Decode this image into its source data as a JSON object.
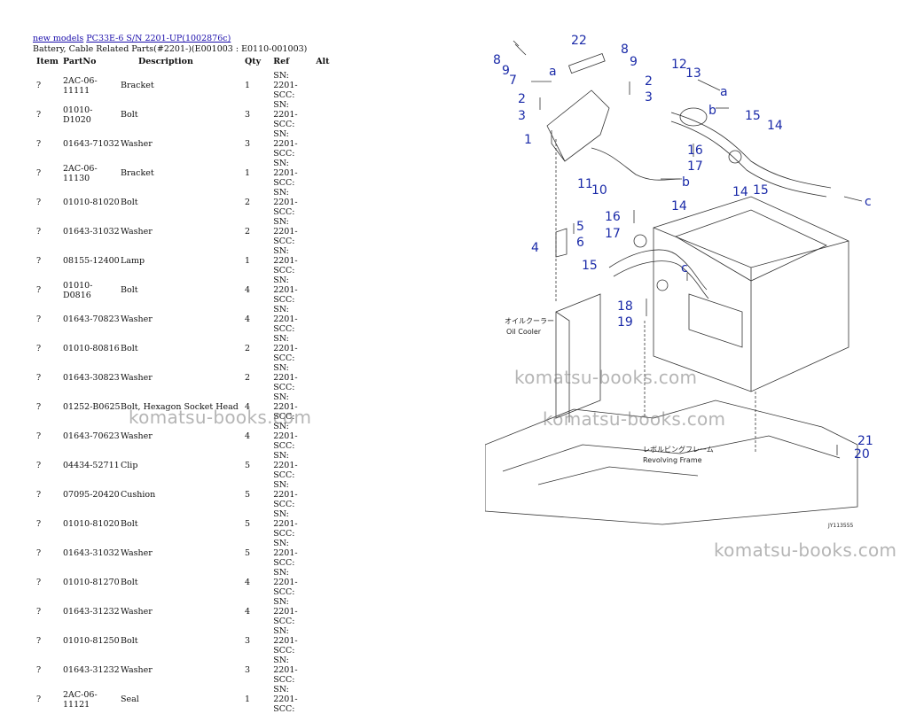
{
  "breadcrumb": {
    "link1": "new models",
    "link2": "PC33E-6 S/N 2201-UP(1002876c)"
  },
  "subtitle": "Battery, Cable Related Parts(#2201-)(E001003 : E0110-001003)",
  "table": {
    "headers": [
      "Item",
      "PartNo",
      "Description",
      "Qty",
      "Ref",
      "Alt"
    ],
    "rows": [
      {
        "item": "?",
        "part": "2AC-06-11111",
        "desc": "Bracket",
        "qty": "1",
        "ref": "SN: 2201- SCC:",
        "alt": ""
      },
      {
        "item": "?",
        "part": "01010-D1020",
        "desc": "Bolt",
        "qty": "3",
        "ref": "SN: 2201- SCC:",
        "alt": ""
      },
      {
        "item": "?",
        "part": "01643-71032",
        "desc": "Washer",
        "qty": "3",
        "ref": "SN: 2201- SCC:",
        "alt": ""
      },
      {
        "item": "?",
        "part": "2AC-06-11130",
        "desc": "Bracket",
        "qty": "1",
        "ref": "SN: 2201- SCC:",
        "alt": ""
      },
      {
        "item": "?",
        "part": "01010-81020",
        "desc": "Bolt",
        "qty": "2",
        "ref": "SN: 2201- SCC:",
        "alt": ""
      },
      {
        "item": "?",
        "part": "01643-31032",
        "desc": "Washer",
        "qty": "2",
        "ref": "SN: 2201- SCC:",
        "alt": ""
      },
      {
        "item": "?",
        "part": "08155-12400",
        "desc": "Lamp",
        "qty": "1",
        "ref": "SN: 2201- SCC:",
        "alt": ""
      },
      {
        "item": "?",
        "part": "01010-D0816",
        "desc": "Bolt",
        "qty": "4",
        "ref": "SN: 2201- SCC:",
        "alt": ""
      },
      {
        "item": "?",
        "part": "01643-70823",
        "desc": "Washer",
        "qty": "4",
        "ref": "SN: 2201- SCC:",
        "alt": ""
      },
      {
        "item": "?",
        "part": "01010-80816",
        "desc": "Bolt",
        "qty": "2",
        "ref": "SN: 2201- SCC:",
        "alt": ""
      },
      {
        "item": "?",
        "part": "01643-30823",
        "desc": "Washer",
        "qty": "2",
        "ref": "SN: 2201- SCC:",
        "alt": ""
      },
      {
        "item": "?",
        "part": "01252-B0625",
        "desc": "Bolt, Hexagon Socket Head",
        "qty": "4",
        "ref": "SN: 2201- SCC:",
        "alt": ""
      },
      {
        "item": "?",
        "part": "01643-70623",
        "desc": "Washer",
        "qty": "4",
        "ref": "SN: 2201- SCC:",
        "alt": ""
      },
      {
        "item": "?",
        "part": "04434-52711",
        "desc": "Clip",
        "qty": "5",
        "ref": "SN: 2201- SCC:",
        "alt": ""
      },
      {
        "item": "?",
        "part": "07095-20420",
        "desc": "Cushion",
        "qty": "5",
        "ref": "SN: 2201- SCC:",
        "alt": ""
      },
      {
        "item": "?",
        "part": "01010-81020",
        "desc": "Bolt",
        "qty": "5",
        "ref": "SN: 2201- SCC:",
        "alt": ""
      },
      {
        "item": "?",
        "part": "01643-31032",
        "desc": "Washer",
        "qty": "5",
        "ref": "SN: 2201- SCC:",
        "alt": ""
      },
      {
        "item": "?",
        "part": "01010-81270",
        "desc": "Bolt",
        "qty": "4",
        "ref": "SN: 2201- SCC:",
        "alt": ""
      },
      {
        "item": "?",
        "part": "01643-31232",
        "desc": "Washer",
        "qty": "4",
        "ref": "SN: 2201- SCC:",
        "alt": ""
      },
      {
        "item": "?",
        "part": "01010-81250",
        "desc": "Bolt",
        "qty": "3",
        "ref": "SN: 2201- SCC:",
        "alt": ""
      },
      {
        "item": "?",
        "part": "01643-31232",
        "desc": "Washer",
        "qty": "3",
        "ref": "SN: 2201- SCC:",
        "alt": ""
      },
      {
        "item": "?",
        "part": "2AC-06-11121",
        "desc": "Seal",
        "qty": "1",
        "ref": "SN: 2201- SCC:",
        "alt": ""
      }
    ]
  },
  "diagram": {
    "callouts": [
      "1",
      "2",
      "2",
      "3",
      "3",
      "4",
      "5",
      "6",
      "7",
      "8",
      "8",
      "9",
      "9",
      "10",
      "11",
      "12",
      "13",
      "14",
      "14",
      "14",
      "15",
      "15",
      "15",
      "16",
      "16",
      "17",
      "17",
      "18",
      "19",
      "20",
      "21",
      "22"
    ],
    "arrow_letters": [
      "a",
      "a",
      "b",
      "b",
      "c",
      "c"
    ],
    "labels": {
      "oil_cooler_jp": "オイルクーラー",
      "oil_cooler": "Oil Cooler",
      "revolving_frame_jp": "レボルビングフレーム",
      "revolving_frame": "Revolving Frame",
      "drawing_code": "JY113555"
    }
  },
  "watermarks": [
    "komatsu-books.com",
    "komatsu-books.com",
    "komatsu-books.com",
    "komatsu-books.com"
  ]
}
